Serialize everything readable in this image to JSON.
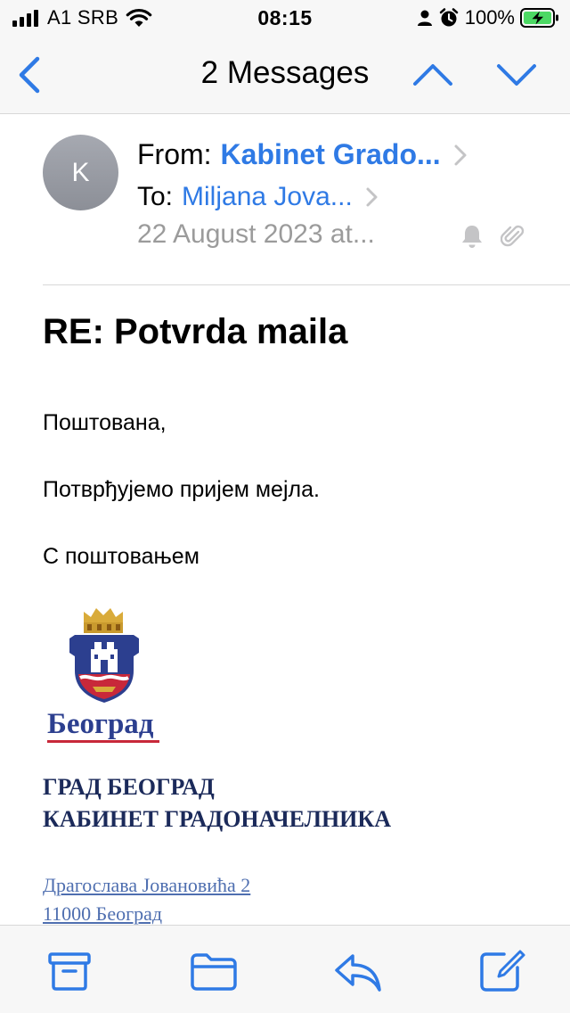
{
  "status_bar": {
    "carrier": "A1 SRB",
    "time": "08:15",
    "battery": "100%"
  },
  "nav": {
    "title": "2 Messages"
  },
  "header": {
    "avatar_initial": "K",
    "from_label": "From:",
    "from_name": "Kabinet Grado...",
    "to_label": "To:",
    "to_name": "Miljana Jova...",
    "date": "22 August 2023 at..."
  },
  "message": {
    "subject": "RE: Potvrda maila",
    "greeting": "Поштована,",
    "body": "Потврђујемо пријем мејла.",
    "closing": "С поштовањем",
    "logo_text": "Београд",
    "org_line1": "ГРАД БЕОГРАД",
    "org_line2": "КАБИНЕТ ГРАДОНАЧЕЛНИКА",
    "address_line1": "Драгослава Јовановића 2",
    "address_line2": "11000 Београд"
  },
  "colors": {
    "accent": "#2f7ae5",
    "org_text": "#1b2a5a",
    "link": "#4f6fb0"
  },
  "icons": {
    "back": "chevron-left-icon",
    "prev": "chevron-up-icon",
    "next": "chevron-down-icon",
    "notify": "bell-icon",
    "attachment": "paperclip-icon",
    "archive": "archive-icon",
    "move": "folder-icon",
    "reply": "reply-icon",
    "compose": "compose-icon"
  }
}
